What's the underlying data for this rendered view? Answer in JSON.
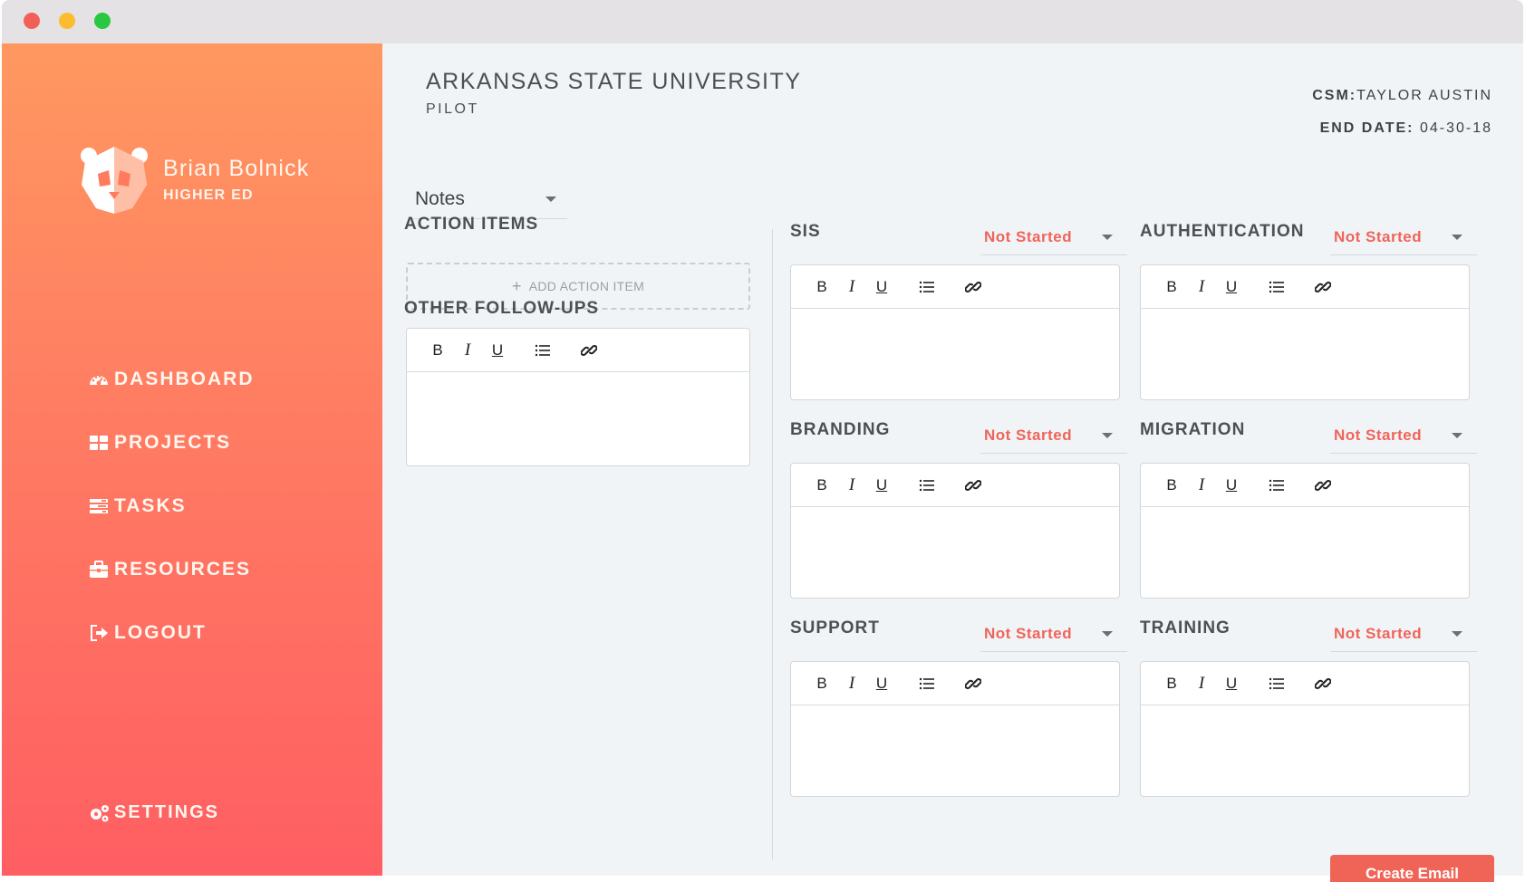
{
  "window": {
    "controls": [
      "close",
      "minimize",
      "maximize"
    ]
  },
  "sidebar": {
    "profile": {
      "name": "Brian Bolnick",
      "subtitle": "HIGHER ED",
      "avatar_icon": "panda-logo-icon"
    },
    "nav": [
      {
        "label": "DASHBOARD",
        "icon": "dashboard-icon"
      },
      {
        "label": "PROJECTS",
        "icon": "grid-icon"
      },
      {
        "label": "TASKS",
        "icon": "tasks-icon"
      },
      {
        "label": "RESOURCES",
        "icon": "briefcase-icon"
      },
      {
        "label": "LOGOUT",
        "icon": "logout-icon"
      }
    ],
    "settings_label": "SETTINGS",
    "gradient": [
      "#ff9860",
      "#ff5e62"
    ]
  },
  "header": {
    "university": "ARKANSAS STATE UNIVERSITY",
    "phase": "PILOT",
    "csm_label": "CSM:",
    "csm_value": "TAYLOR AUSTIN",
    "end_date_label": "END DATE:",
    "end_date_value": "04-30-18"
  },
  "notes_select": {
    "value": "Notes"
  },
  "action_items": {
    "heading": "ACTION ITEMS",
    "add_label": "ADD ACTION ITEM"
  },
  "follow_ups": {
    "heading": "OTHER FOLLOW-UPS"
  },
  "toolbar": {
    "bold": "B",
    "italic": "I",
    "underline": "U",
    "list_icon": "list-icon",
    "link_icon": "link-icon"
  },
  "sections": [
    {
      "title": "SIS",
      "status": "Not Started"
    },
    {
      "title": "AUTHENTICATION",
      "status": "Not Started"
    },
    {
      "title": "BRANDING",
      "status": "Not Started"
    },
    {
      "title": "MIGRATION",
      "status": "Not Started"
    },
    {
      "title": "SUPPORT",
      "status": "Not Started"
    },
    {
      "title": "TRAINING",
      "status": "Not Started"
    }
  ],
  "create_email_label": "Create Email",
  "colors": {
    "accent": "#f06457",
    "status_text": "#f0645a",
    "main_bg": "#f1f4f7"
  }
}
